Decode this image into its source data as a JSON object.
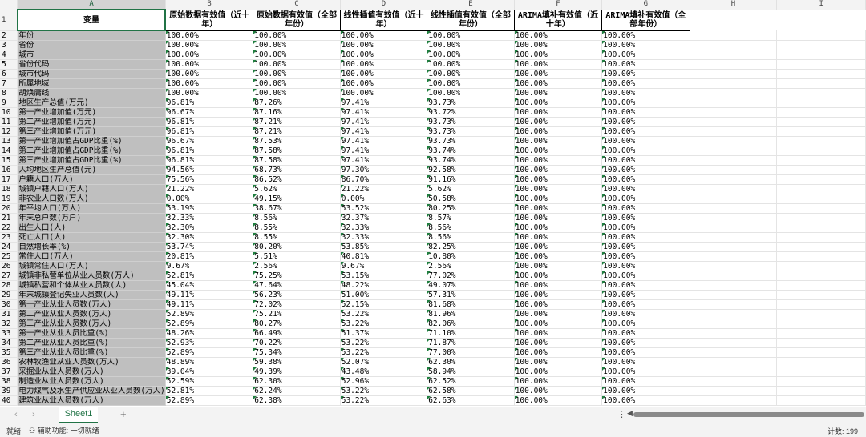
{
  "columns": [
    "A",
    "B",
    "C",
    "D",
    "E",
    "F",
    "G",
    "H",
    "I"
  ],
  "selected_column": "A",
  "headers": [
    "变量",
    "原始数据有效值（近十年）",
    "原始数据有效值（全部年份）",
    "线性插值有效值（近十年）",
    "线性插值有效值（全部年份）",
    "ARIMA填补有效值（近十年）",
    "ARIMA填补有效值（全部年份）"
  ],
  "rows": [
    [
      "年份",
      "100.00%",
      "100.00%",
      "100.00%",
      "100.00%",
      "100.00%",
      "100.00%"
    ],
    [
      "省份",
      "100.00%",
      "100.00%",
      "100.00%",
      "100.00%",
      "100.00%",
      "100.00%"
    ],
    [
      "城市",
      "100.00%",
      "100.00%",
      "100.00%",
      "100.00%",
      "100.00%",
      "100.00%"
    ],
    [
      "省份代码",
      "100.00%",
      "100.00%",
      "100.00%",
      "100.00%",
      "100.00%",
      "100.00%"
    ],
    [
      "城市代码",
      "100.00%",
      "100.00%",
      "100.00%",
      "100.00%",
      "100.00%",
      "100.00%"
    ],
    [
      "所属地域",
      "100.00%",
      "100.00%",
      "100.00%",
      "100.00%",
      "100.00%",
      "100.00%"
    ],
    [
      "胡焕庸线",
      "100.00%",
      "100.00%",
      "100.00%",
      "100.00%",
      "100.00%",
      "100.00%"
    ],
    [
      "地区生产总值(万元)",
      "96.81%",
      "87.26%",
      "97.41%",
      "93.73%",
      "100.00%",
      "100.00%"
    ],
    [
      "第一产业增加值(万元)",
      "96.67%",
      "87.16%",
      "97.41%",
      "93.72%",
      "100.00%",
      "100.00%"
    ],
    [
      "第二产业增加值(万元)",
      "96.81%",
      "87.21%",
      "97.41%",
      "93.73%",
      "100.00%",
      "100.00%"
    ],
    [
      "第三产业增加值(万元)",
      "96.81%",
      "87.21%",
      "97.41%",
      "93.73%",
      "100.00%",
      "100.00%"
    ],
    [
      "第一产业增加值占GDP比重(%)",
      "96.67%",
      "87.53%",
      "97.41%",
      "93.73%",
      "100.00%",
      "100.00%"
    ],
    [
      "第二产业增加值占GDP比重(%)",
      "96.81%",
      "87.58%",
      "97.41%",
      "93.74%",
      "100.00%",
      "100.00%"
    ],
    [
      "第三产业增加值占GDP比重(%)",
      "96.81%",
      "87.58%",
      "97.41%",
      "93.74%",
      "100.00%",
      "100.00%"
    ],
    [
      "人均地区生产总值(元)",
      "94.56%",
      "68.73%",
      "97.30%",
      "92.58%",
      "100.00%",
      "100.00%"
    ],
    [
      "户籍人口(万人)",
      "75.56%",
      "86.52%",
      "86.70%",
      "91.16%",
      "100.00%",
      "100.00%"
    ],
    [
      "城镇户籍人口(万人)",
      "21.22%",
      "5.62%",
      "21.22%",
      "5.62%",
      "100.00%",
      "100.00%"
    ],
    [
      "非农业人口数(万人)",
      "0.00%",
      "49.15%",
      "0.00%",
      "50.58%",
      "100.00%",
      "100.00%"
    ],
    [
      "年平均人口(万人)",
      "53.19%",
      "38.67%",
      "53.52%",
      "80.25%",
      "100.00%",
      "100.00%"
    ],
    [
      "年末总户数(万户)",
      "32.33%",
      "8.56%",
      "32.37%",
      "8.57%",
      "100.00%",
      "100.00%"
    ],
    [
      "出生人口(人)",
      "32.30%",
      "8.55%",
      "32.33%",
      "8.56%",
      "100.00%",
      "100.00%"
    ],
    [
      "死亡人口(人)",
      "32.30%",
      "8.55%",
      "32.33%",
      "8.56%",
      "100.00%",
      "100.00%"
    ],
    [
      "自然增长率(%)",
      "53.74%",
      "80.20%",
      "53.85%",
      "82.25%",
      "100.00%",
      "100.00%"
    ],
    [
      "常住人口(万人)",
      "20.81%",
      "5.51%",
      "40.81%",
      "10.80%",
      "100.00%",
      "100.00%"
    ],
    [
      "城镇常住人口(万人)",
      "9.67%",
      "2.56%",
      "9.67%",
      "2.56%",
      "100.00%",
      "100.00%"
    ],
    [
      "城镇非私营单位从业人员数(万人)",
      "52.81%",
      "75.25%",
      "53.15%",
      "77.02%",
      "100.00%",
      "100.00%"
    ],
    [
      "城镇私营和个体从业人员数(人)",
      "45.04%",
      "47.64%",
      "48.22%",
      "49.07%",
      "100.00%",
      "100.00%"
    ],
    [
      "年末城镇登记失业人员数(人)",
      "49.11%",
      "56.23%",
      "51.00%",
      "57.31%",
      "100.00%",
      "100.00%"
    ],
    [
      "第一产业从业人员数(万人)",
      "49.11%",
      "72.02%",
      "52.15%",
      "81.68%",
      "100.00%",
      "100.00%"
    ],
    [
      "第二产业从业人员数(万人)",
      "52.89%",
      "75.21%",
      "53.22%",
      "81.96%",
      "100.00%",
      "100.00%"
    ],
    [
      "第三产业从业人员数(万人)",
      "52.89%",
      "80.27%",
      "53.22%",
      "82.06%",
      "100.00%",
      "100.00%"
    ],
    [
      "第一产业从业人员比重(%)",
      "48.26%",
      "66.49%",
      "51.37%",
      "71.10%",
      "100.00%",
      "100.00%"
    ],
    [
      "第二产业从业人员比重(%)",
      "52.93%",
      "70.22%",
      "53.22%",
      "71.87%",
      "100.00%",
      "100.00%"
    ],
    [
      "第三产业从业人员比重(%)",
      "52.89%",
      "75.34%",
      "53.22%",
      "77.00%",
      "100.00%",
      "100.00%"
    ],
    [
      "农林牧渔业从业人员数(万人)",
      "48.89%",
      "59.38%",
      "52.07%",
      "62.30%",
      "100.00%",
      "100.00%"
    ],
    [
      "采掘业从业人员数(万人)",
      "39.04%",
      "49.39%",
      "43.48%",
      "58.94%",
      "100.00%",
      "100.00%"
    ],
    [
      "制造业从业人员数(万人)",
      "52.59%",
      "62.30%",
      "52.96%",
      "62.52%",
      "100.00%",
      "100.00%"
    ],
    [
      "电力煤气及水生产供应业从业人员数(万人)",
      "52.81%",
      "62.24%",
      "53.22%",
      "62.58%",
      "100.00%",
      "100.00%"
    ],
    [
      "建筑业从业人员数(万人)",
      "52.89%",
      "62.38%",
      "53.22%",
      "62.63%",
      "100.00%",
      "100.00%"
    ]
  ],
  "tabs": {
    "nav_prev": "‹",
    "nav_next": "›",
    "sheet1": "Sheet1",
    "add": "+"
  },
  "status": {
    "ready": "就绪",
    "accessibility": "辅助功能: 一切就绪",
    "count": "计数: 199"
  },
  "colors": {
    "accent": "#217346",
    "var_col_bg": "#bfbfbf"
  }
}
